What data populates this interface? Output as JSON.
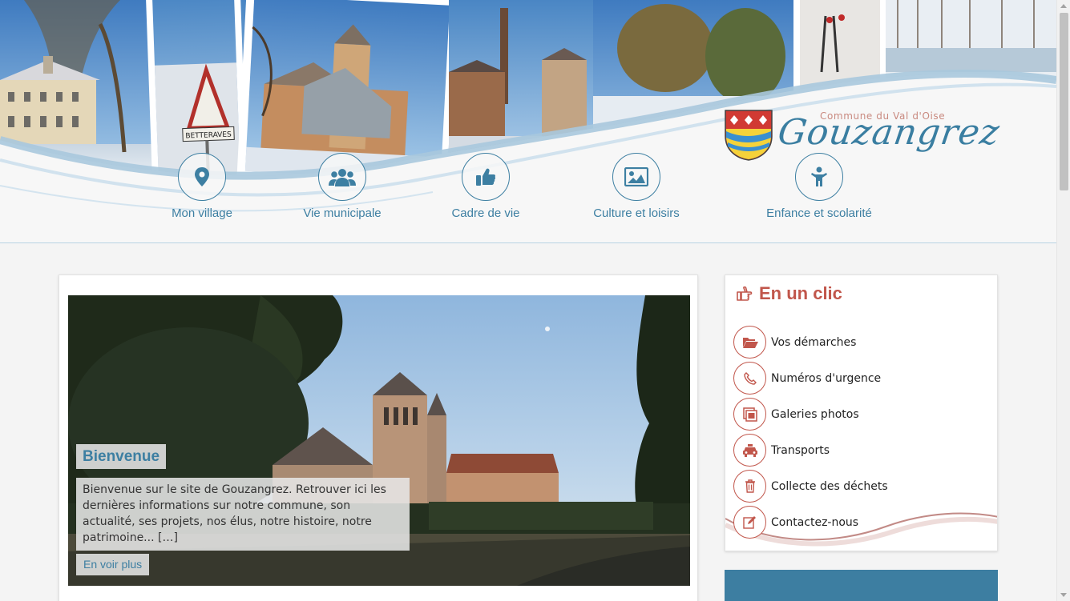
{
  "header": {
    "logo": {
      "subtitle": "Commune du Val d'Oise",
      "name": "Gouzangrez"
    },
    "nav": [
      {
        "label": "Mon village",
        "icon": "map-marker-icon"
      },
      {
        "label": "Vie municipale",
        "icon": "users-icon"
      },
      {
        "label": "Cadre de vie",
        "icon": "thumbs-up-icon"
      },
      {
        "label": "Culture et loisirs",
        "icon": "picture-icon"
      },
      {
        "label": "Enfance et scolarité",
        "icon": "child-icon"
      }
    ],
    "banner_photo_text": "BETTERAVES"
  },
  "slider": {
    "title": "Bienvenue",
    "text": "Bienvenue sur le site de Gouzangrez. Retrouver ici les dernières informations sur notre commune, son actualité, ses projets, nos élus, notre histoire, notre patrimoine... […]",
    "more_label": "En voir plus"
  },
  "quick_links": {
    "title": "En un clic",
    "items": [
      {
        "label": "Vos démarches",
        "icon": "folder-open-icon"
      },
      {
        "label": "Numéros d'urgence",
        "icon": "phone-icon"
      },
      {
        "label": "Galeries photos",
        "icon": "photo-gallery-icon"
      },
      {
        "label": "Transports",
        "icon": "taxi-icon"
      },
      {
        "label": "Collecte des déchets",
        "icon": "trash-icon"
      },
      {
        "label": "Contactez-nous",
        "icon": "edit-icon"
      }
    ]
  },
  "colors": {
    "primary_blue": "#3d7fa2",
    "accent_red": "#c1564b",
    "page_background": "#f4f4f4"
  }
}
